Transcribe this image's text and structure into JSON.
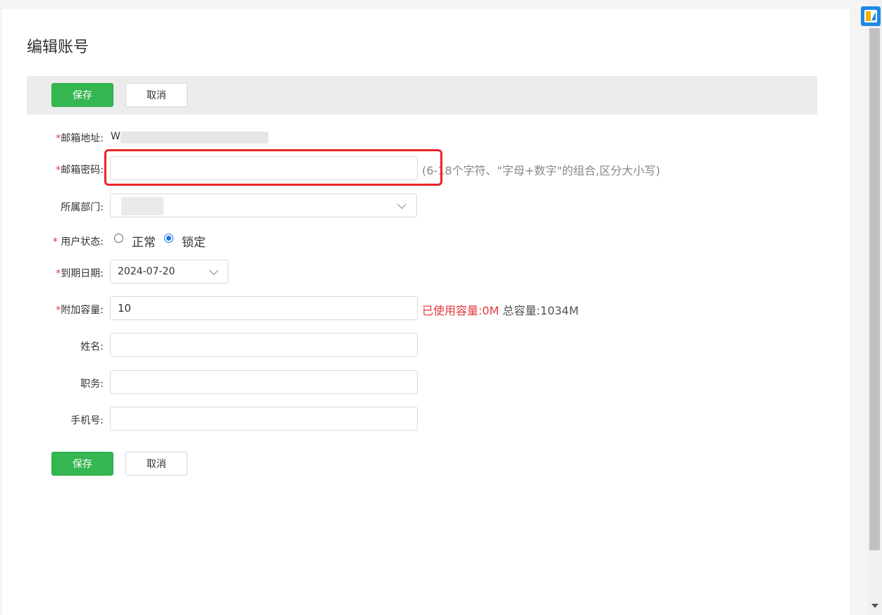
{
  "page": {
    "title": "编辑账号"
  },
  "toolbar": {
    "save_label": "保存",
    "cancel_label": "取消"
  },
  "form": {
    "email": {
      "label": "邮箱地址:",
      "value_prefix": "W"
    },
    "password": {
      "label": "邮箱密码:",
      "value": "",
      "hint": "(6-18个字符、\"字母+数字\"的组合,区分大小写)"
    },
    "department": {
      "label": "所属部门:"
    },
    "status": {
      "label": "用户状态:",
      "options": [
        "正常",
        "锁定"
      ],
      "selected": "锁定"
    },
    "expiry": {
      "label": "到期日期:",
      "value": "2024-07-20"
    },
    "capacity": {
      "label": "附加容量:",
      "value": "10",
      "used_label": "已使用容量:",
      "used_value": "0M",
      "total_label": "总容量:",
      "total_value": "1034M"
    },
    "name": {
      "label": "姓名:",
      "value": ""
    },
    "position": {
      "label": "职务:",
      "value": ""
    },
    "phone": {
      "label": "手机号:",
      "value": ""
    }
  },
  "footer": {
    "save_label": "保存",
    "cancel_label": "取消"
  },
  "colors": {
    "primary": "#34b650",
    "required": "#e4393c",
    "highlight": "#e8262a",
    "radio_checked": "#1a73e8"
  }
}
